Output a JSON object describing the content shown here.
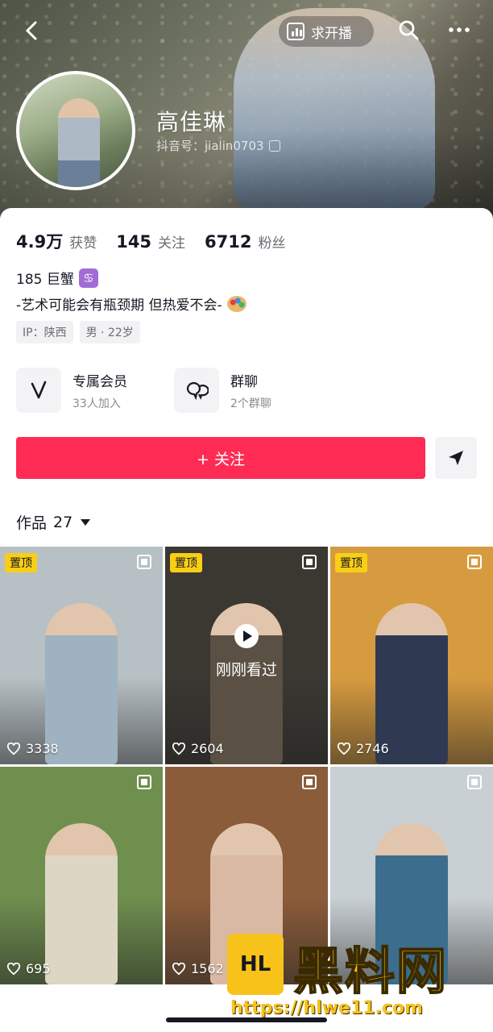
{
  "header": {
    "live_button": "求开播",
    "name": "高佳琳",
    "douyin_id": "抖音号：jialin0703"
  },
  "stats": [
    {
      "num": "4.9万",
      "label": "获赞"
    },
    {
      "num": "145",
      "label": "关注"
    },
    {
      "num": "6712",
      "label": "粉丝"
    }
  ],
  "bio": {
    "line1": "185 巨蟹",
    "line1_badge": "♋",
    "line2": "-艺术可能会有瓶颈期 但热爱不会-",
    "tags": [
      "IP：陕西",
      "男 · 22岁"
    ]
  },
  "features": [
    {
      "title": "专属会员",
      "subtitle": "33人加入"
    },
    {
      "title": "群聊",
      "subtitle": "2个群聊"
    }
  ],
  "follow_button": "+ 关注",
  "works_tab": {
    "label": "作品",
    "count": "27"
  },
  "tiles": [
    {
      "pinned": "置顶",
      "likes": "3338",
      "bg": "#b7c0c4",
      "fg": "#9fb2bf"
    },
    {
      "pinned": "置顶",
      "likes": "2604",
      "bg": "#3b3832",
      "fg": "#5a5144",
      "recent": "刚刚看过"
    },
    {
      "pinned": "置顶",
      "likes": "2746",
      "bg": "#d79b3f",
      "fg": "#2f3a52"
    },
    {
      "likes": "695",
      "bg": "#6f8f4e",
      "fg": "#ddd6c4"
    },
    {
      "likes": "1562",
      "bg": "#8b5c3a",
      "fg": "#d9b9a4"
    },
    {
      "likes": "",
      "bg": "#c9d0d4",
      "fg": "#3c6d8c"
    }
  ],
  "watermark": {
    "logo": "HL",
    "title": "黑料网",
    "url": "https://hlwe11.com"
  },
  "colors": {
    "accent": "#fe2c55",
    "pin": "#face15"
  }
}
